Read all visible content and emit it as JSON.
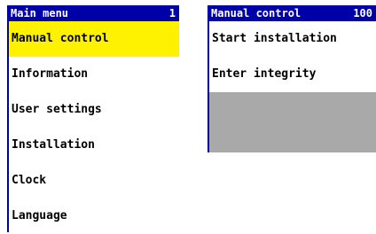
{
  "main_menu": {
    "title": "Main menu",
    "page_number": "1",
    "items": [
      {
        "label": "Manual control",
        "selected": true
      },
      {
        "label": "Information",
        "selected": false
      },
      {
        "label": "User settings",
        "selected": false
      },
      {
        "label": "Installation",
        "selected": false
      },
      {
        "label": "Clock",
        "selected": false
      },
      {
        "label": "Language",
        "selected": false
      }
    ]
  },
  "manual_control": {
    "title": "Manual control",
    "page_number": "100",
    "items": [
      {
        "label": "Start installation"
      },
      {
        "label": "Enter integrity"
      }
    ]
  },
  "colors": {
    "title_bar": "#0000a8",
    "selection": "#fff200",
    "empty_area": "#a9a9a9"
  }
}
